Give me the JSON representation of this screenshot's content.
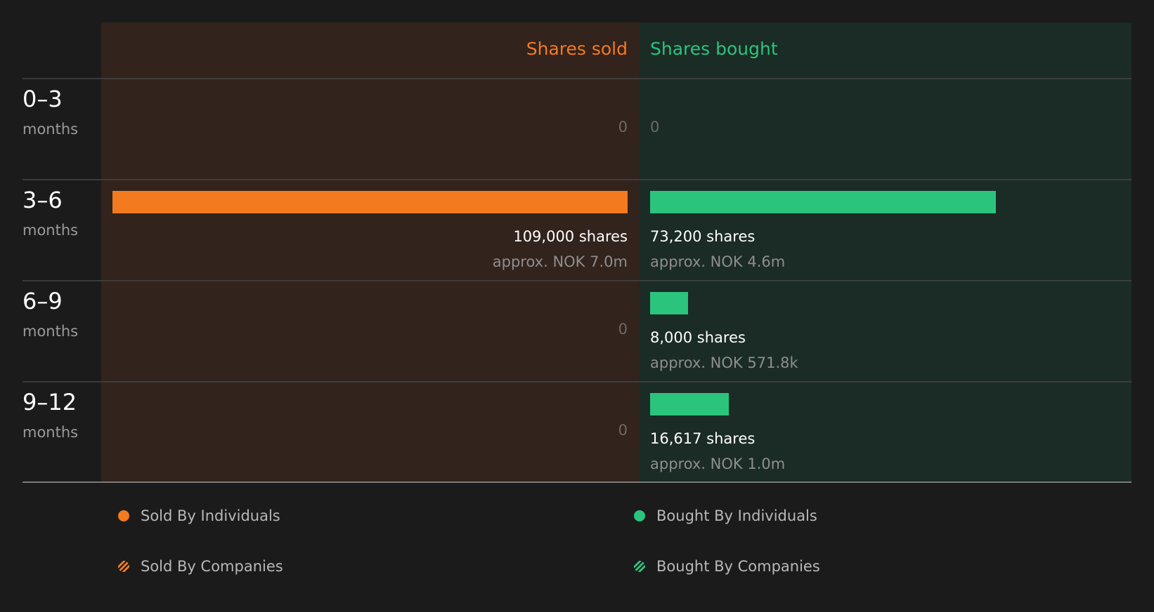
{
  "chart_data": {
    "type": "bar",
    "orientation": "diverging-horizontal",
    "headers": {
      "sold": "Shares sold",
      "bought": "Shares bought"
    },
    "categories": [
      {
        "range": "0–3",
        "unit": "months"
      },
      {
        "range": "3–6",
        "unit": "months"
      },
      {
        "range": "6–9",
        "unit": "months"
      },
      {
        "range": "9–12",
        "unit": "months"
      }
    ],
    "series": [
      {
        "name": "Shares sold",
        "values": [
          0,
          109000,
          0,
          0
        ],
        "labels": [
          "0",
          "109,000 shares",
          "0",
          "0"
        ],
        "value_labels": [
          "",
          "approx. NOK 7.0m",
          "",
          ""
        ]
      },
      {
        "name": "Shares bought",
        "values": [
          0,
          73200,
          8000,
          16617
        ],
        "labels": [
          "0",
          "73,200 shares",
          "8,000 shares",
          "16,617 shares"
        ],
        "value_labels": [
          "",
          "approx. NOK 4.6m",
          "approx. NOK 571.8k",
          "approx. NOK 1.0m"
        ]
      }
    ],
    "xlim": [
      0,
      109000
    ],
    "legend": {
      "placement": "bottom",
      "items": [
        {
          "label": "Sold By Individuals",
          "style": "solid",
          "color": "#f47a1f"
        },
        {
          "label": "Bought By Individuals",
          "style": "solid",
          "color": "#2bc47d"
        },
        {
          "label": "Sold By Companies",
          "style": "hatched",
          "color": "#f47a1f"
        },
        {
          "label": "Bought By Companies",
          "style": "hatched",
          "color": "#2bc47d"
        }
      ]
    },
    "colors": {
      "sold": "#f47a1f",
      "bought": "#2bc47d",
      "sold_bg": "#32231c",
      "bought_bg": "#1b2b25",
      "page_bg": "#1b1b1b"
    }
  }
}
